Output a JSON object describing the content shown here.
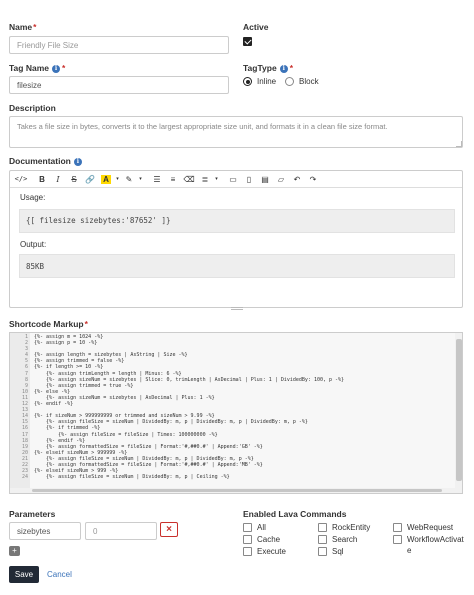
{
  "name": {
    "label": "Name",
    "required": "*",
    "placeholder": "Friendly File Size"
  },
  "active": {
    "label": "Active",
    "checked": true
  },
  "tag_name": {
    "label": "Tag Name",
    "required": "*",
    "value": "filesize"
  },
  "tag_type": {
    "label": "TagType",
    "options": [
      "Inline",
      "Block"
    ],
    "selected": "Inline"
  },
  "description": {
    "label": "Description",
    "value": "Takes a file size in bytes, converts it to the largest appropriate size unit, and formats it in a clean file size format."
  },
  "documentation": {
    "label": "Documentation",
    "usage_label": "Usage:",
    "usage_code": "{[ filesize sizebytes:'87652' ]}",
    "output_label": "Output:",
    "output_value": "85KB"
  },
  "shortcode": {
    "label": "Shortcode Markup",
    "required": "*",
    "lines": [
      "{%- assign m = 1024 -%}",
      "{%- assign p = 10 -%}",
      "",
      "{%- assign length = sizebytes | AsString | Size -%}",
      "{%- assign trimmed = false -%}",
      "{%- if length >= 10 -%}",
      "    {%- assign trimLength = length | Minus: 6 -%}",
      "    {%- assign sizeNum = sizebytes | Slice: 0, trimLength | AsDecimal | Plus: 1 | DividedBy: 100, p -%}",
      "    {%- assign trimmed = true -%}",
      "{%- else -%}",
      "    {%- assign sizeNum = sizebytes | AsDecimal | Plus: 1 -%}",
      "{%- endif -%}",
      "",
      "{%- if sizeNum > 999999999 or trimmed and sizeNum > 9.99 -%}",
      "    {%- assign fileSize = sizeNum | DividedBy: m, p | DividedBy: m, p | DividedBy: m, p -%}",
      "    {%- if trimmed -%}",
      "        {%- assign fileSize = fileSize | Times: 100000000 -%}",
      "    {%- endif -%}",
      "    {%- assign formattedSize = fileSize | Format:'#,##0.#' | Append:'GB' -%}",
      "{%- elseif sizeNum > 999999 -%}",
      "    {%- assign fileSize = sizeNum | DividedBy: m, p | DividedBy: m, p -%}",
      "    {%- assign formattedSize = fileSize | Format:'#,##0.#' | Append:'MB' -%}",
      "{%- elseif sizeNum > 999 -%}",
      "    {%- assign fileSize = sizeNum | DividedBy: m, p | Ceiling -%}"
    ],
    "line_numbers": [
      "1",
      "2",
      "3",
      "4",
      "5",
      "6",
      "7",
      "8",
      "9",
      "10",
      "11",
      "12",
      "13",
      "14",
      "15",
      "16",
      "17",
      "18",
      "19",
      "20",
      "21",
      "22",
      "23",
      "24"
    ]
  },
  "parameters": {
    "label": "Parameters",
    "key_value": "sizebytes",
    "value_value": "0",
    "remove_icon": "×",
    "add_icon": "+"
  },
  "lava_commands": {
    "label": "Enabled Lava Commands",
    "items": [
      {
        "label": "All"
      },
      {
        "label": "RockEntity"
      },
      {
        "label": "WebRequest"
      },
      {
        "label": "Cache"
      },
      {
        "label": "Search"
      },
      {
        "label": "WorkflowActivat"
      },
      {
        "label": "Execute"
      },
      {
        "label": "Sql"
      },
      {
        "label": "e"
      }
    ]
  },
  "actions": {
    "save": "Save",
    "cancel": "Cancel"
  },
  "toolbar_icons": [
    "code-view-icon",
    "bold-icon",
    "italic-icon",
    "strikethrough-icon",
    "link-icon",
    "font-color-icon",
    "style-icon",
    "unordered-list-icon",
    "ordered-list-icon",
    "eraser-icon",
    "align-icon",
    "image-icon",
    "file-icon",
    "paste-icon",
    "lava-icon",
    "undo-icon",
    "redo-icon"
  ]
}
